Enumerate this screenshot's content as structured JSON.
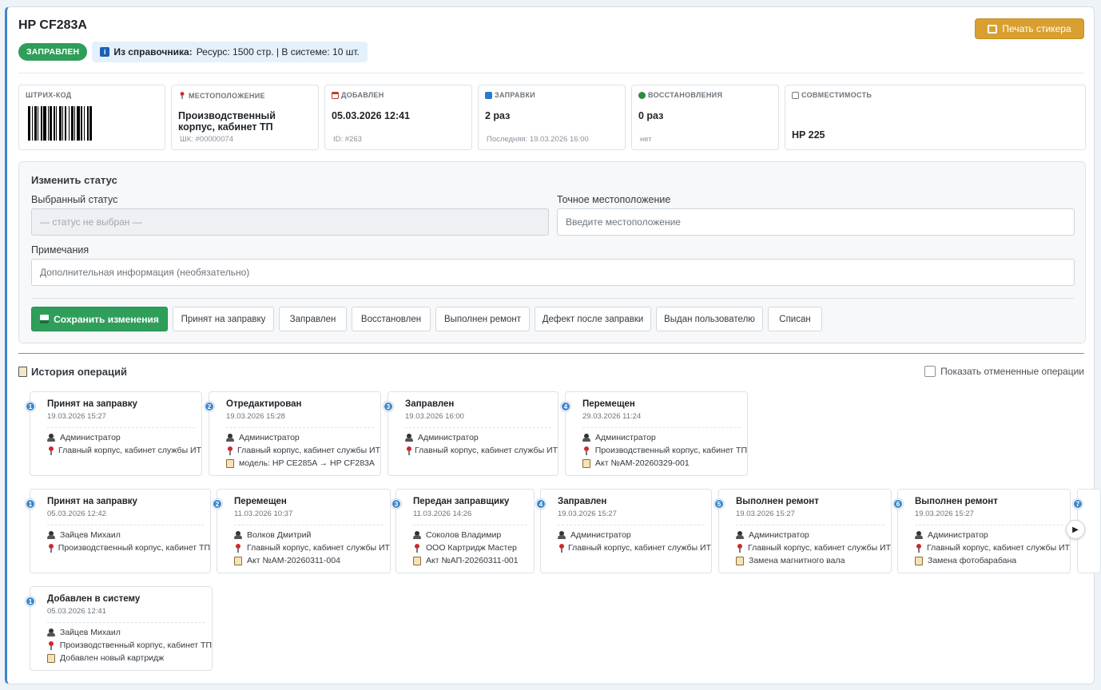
{
  "header": {
    "title": "HP CF283A",
    "status_badge": "ЗАПРАВЛЕН",
    "print_button": "Печать стикера",
    "ref_prefix": "Из справочника:",
    "ref_text": "Ресурс: 1500 стр. | В системе: 10 шт."
  },
  "cards": {
    "barcode": {
      "label": "ШТРИХ-КОД"
    },
    "location": {
      "label": "МЕСТОПОЛОЖЕНИЕ",
      "value": "Производственный корпус, кабинет ТП",
      "sub": "ШК: #00000074"
    },
    "added": {
      "label": "ДОБАВЛЕН",
      "value": "05.03.2026 12:41",
      "sub": "ID: #263"
    },
    "refills": {
      "label": "ЗАПРАВКИ",
      "value": "2 раз",
      "sub": "Последняя: 19.03.2026 16:00"
    },
    "restorations": {
      "label": "ВОССТАНОВЛЕНИЯ",
      "value": "0 раз",
      "sub": "нет"
    },
    "compat": {
      "label": "СОВМЕСТИМОСТЬ",
      "value": "HP 225"
    }
  },
  "form": {
    "title": "Изменить статус",
    "status_label": "Выбранный статус",
    "status_placeholder": "— статус не выбран —",
    "location_label": "Точное местоположение",
    "location_placeholder": "Введите местоположение",
    "notes_label": "Примечания",
    "notes_placeholder": "Дополнительная информация (необязательно)",
    "save_button": "Сохранить изменения",
    "status_buttons": [
      "Принят на заправку",
      "Заправлен",
      "Восстановлен",
      "Выполнен ремонт",
      "Дефект после заправки",
      "Выдан пользователю",
      "Списан"
    ]
  },
  "history": {
    "title": "История операций",
    "show_cancelled": "Показать отмененные операции",
    "rows": [
      [
        {
          "num": "1",
          "title": "Принят на заправку",
          "date": "19.03.2026 15:27",
          "user": "Администратор",
          "location": "Главный корпус, кабинет службы ИТ"
        },
        {
          "num": "2",
          "title": "Отредактирован",
          "date": "19.03.2026 15:28",
          "user": "Администратор",
          "location": "Главный корпус, кабинет службы ИТ",
          "note": "модель: HP CE285A → HP CF283A"
        },
        {
          "num": "3",
          "title": "Заправлен",
          "date": "19.03.2026 16:00",
          "user": "Администратор",
          "location": "Главный корпус, кабинет службы ИТ"
        },
        {
          "num": "4",
          "title": "Перемещен",
          "date": "29.03.2026 11:24",
          "user": "Администратор",
          "location": "Производственный корпус, кабинет ТП",
          "note": "Акт №АМ-20260329-001"
        }
      ],
      [
        {
          "num": "1",
          "title": "Принят на заправку",
          "date": "05.03.2026 12:42",
          "user": "Зайцев Михаил",
          "location": "Производственный корпус, кабинет ТП"
        },
        {
          "num": "2",
          "title": "Перемещен",
          "date": "11.03.2026 10:37",
          "user": "Волков Дмитрий",
          "location": "Главный корпус, кабинет службы ИТ",
          "note": "Акт №АМ-20260311-004"
        },
        {
          "num": "3",
          "title": "Передан заправщику",
          "date": "11.03.2026 14:26",
          "user": "Соколов Владимир",
          "location": "ООО Картридж Мастер",
          "note": "Акт №АП-20260311-001"
        },
        {
          "num": "4",
          "title": "Заправлен",
          "date": "19.03.2026 15:27",
          "user": "Администратор",
          "location": "Главный корпус, кабинет службы ИТ"
        },
        {
          "num": "5",
          "title": "Выполнен ремонт",
          "date": "19.03.2026 15:27",
          "user": "Администратор",
          "location": "Главный корпус, кабинет службы ИТ",
          "note": "Замена магнитного вала"
        },
        {
          "num": "6",
          "title": "Выполнен ремонт",
          "date": "19.03.2026 15:27",
          "user": "Администратор",
          "location": "Главный корпус, кабинет службы ИТ",
          "note": "Замена фотобарабана"
        },
        {
          "num": "7"
        }
      ],
      [
        {
          "num": "1",
          "title": "Добавлен в систему",
          "date": "05.03.2026 12:41",
          "user": "Зайцев Михаил",
          "location": "Производственный корпус, кабинет ТП",
          "note": "Добавлен новый картридж"
        }
      ]
    ]
  },
  "colors": {
    "accent": "#3f86c9",
    "success": "#2f9e5b",
    "warning": "#d9a031"
  }
}
